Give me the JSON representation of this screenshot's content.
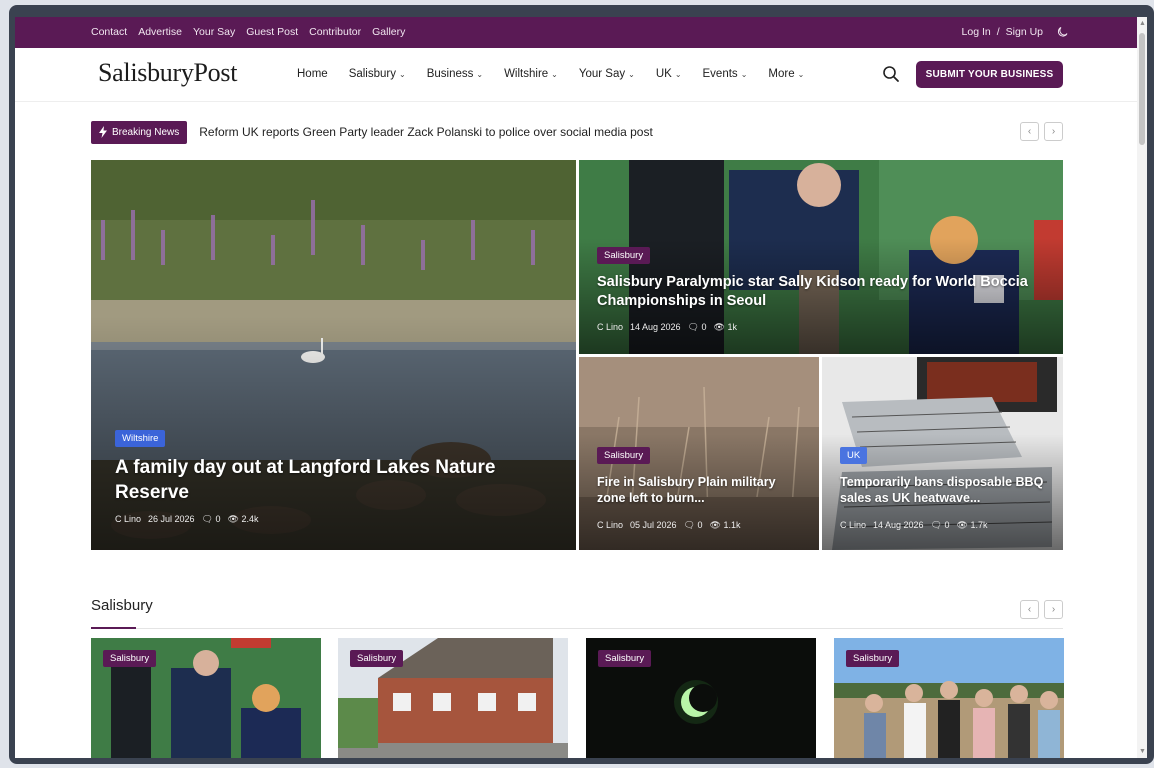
{
  "topbar": {
    "links": [
      "Contact",
      "Advertise",
      "Your Say",
      "Guest Post",
      "Contributor",
      "Gallery"
    ],
    "login": "Log In",
    "sep": "/",
    "signup": "Sign Up"
  },
  "header": {
    "logo": "SalisburyPost",
    "nav": [
      "Home",
      "Salisbury",
      "Business",
      "Wiltshire",
      "Your Say",
      "UK",
      "Events",
      "More"
    ],
    "chevron": "⌄",
    "submit": "SUBMIT YOUR BUSINESS"
  },
  "breaking": {
    "label": "Breaking News",
    "headline": "Reform UK reports Green Party leader Zack Polanski to police over social media post",
    "prev": "‹",
    "next": "›"
  },
  "featured": [
    {
      "tag": "Wiltshire",
      "title": "A family day out at Langford Lakes Nature Reserve",
      "author": "C Lino",
      "date": "26 Jul 2026",
      "comments": "0",
      "views": "2.4k"
    },
    {
      "tag": "Salisbury",
      "title": "Salisbury Paralympic star Sally Kidson ready for World Boccia Championships in Seoul",
      "author": "C Lino",
      "date": "14 Aug 2026",
      "comments": "0",
      "views": "1k"
    },
    {
      "tag": "Salisbury",
      "title": "Fire in Salisbury Plain military zone left to burn...",
      "author": "C Lino",
      "date": "05 Jul 2026",
      "comments": "0",
      "views": "1.1k"
    },
    {
      "tag": "UK",
      "title": "Temporarily bans disposable BBQ sales as UK heatwave...",
      "author": "C Lino",
      "date": "14 Aug 2026",
      "comments": "0",
      "views": "1.7k"
    }
  ],
  "section": {
    "title": "Salisbury",
    "cards": [
      {
        "tag": "Salisbury"
      },
      {
        "tag": "Salisbury"
      },
      {
        "tag": "Salisbury"
      },
      {
        "tag": "Salisbury"
      }
    ]
  },
  "colors": {
    "brand": "#5a1a55",
    "tag_blue": "#3b64d9"
  }
}
